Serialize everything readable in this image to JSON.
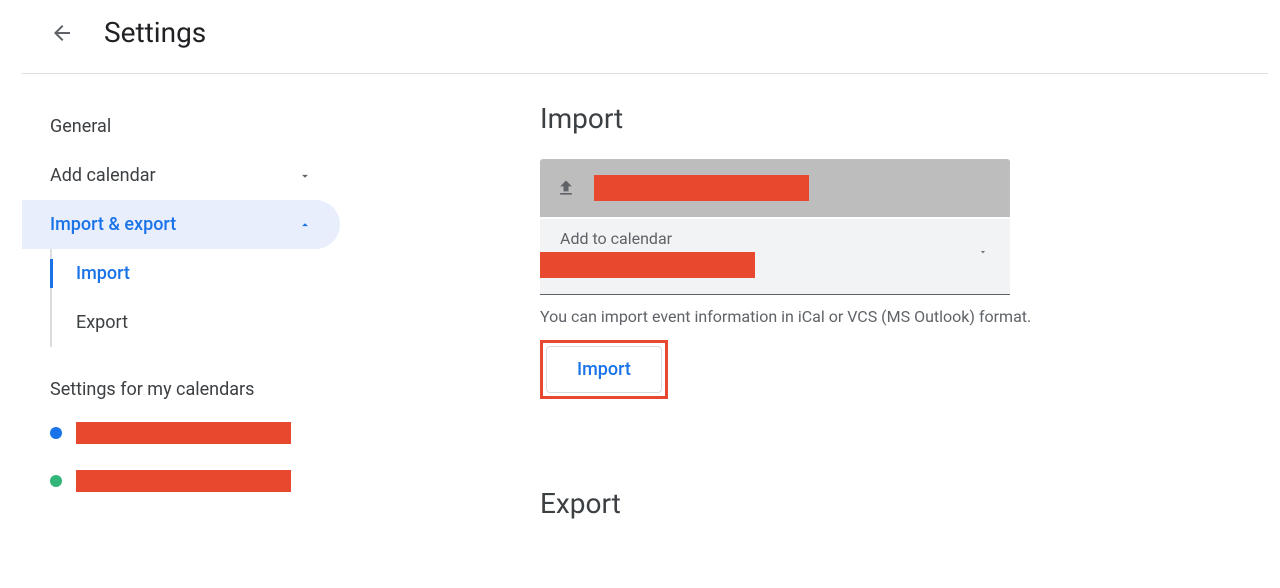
{
  "header": {
    "title": "Settings"
  },
  "sidebar": {
    "general": "General",
    "add_calendar": "Add calendar",
    "import_export": "Import & export",
    "sub_import": "Import",
    "sub_export": "Export",
    "section_my_calendars": "Settings for my calendars"
  },
  "main": {
    "import_title": "Import",
    "add_to_calendar_label": "Add to calendar",
    "helper": "You can import event information in iCal or VCS (MS Outlook) format.",
    "import_button": "Import",
    "export_title": "Export"
  }
}
